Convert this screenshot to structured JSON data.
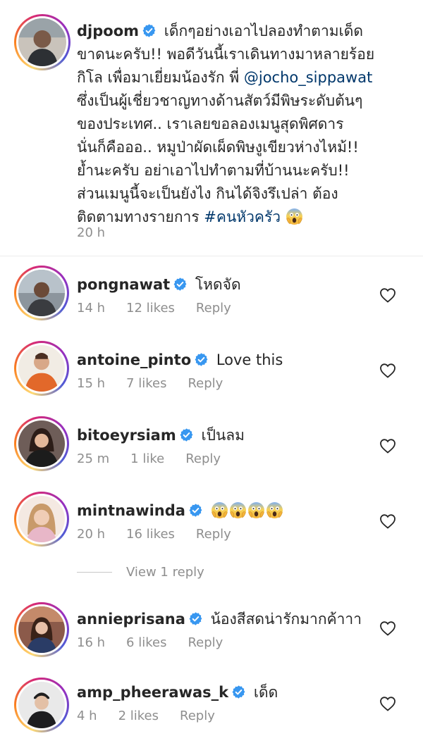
{
  "caption": {
    "username": "djpoom",
    "lines": [
      "เด็กๆอย่างเอาไปลองทำตามเด็ด",
      "ขาดนะครับ!! พอดีวันนี้เราเดินทางมาหลายร้อย",
      "กิโล เพื่อมาเยี่ยมน้องรัก พี่",
      "ซึ่งเป็นผู้เชี่ยวชาญทางด้านสัตว์มีพิษระดับต้นๆ",
      "ของประเทศ.. เราเลยขอลองเมนูสุดพิศดาร",
      "นั่นก็คือออ.. หมูป่าผัดเผ็ดพิษงูเขียวห่างไหม้!!",
      "ย้ำนะครับ อย่าเอาไปทำตามที่บ้านนะครับ!!",
      "ส่วนเมนูนี้จะเป็นยังไง กินได้จิงรึเปล่า ต้อง",
      "ติดตามทางรายการ"
    ],
    "mention": "@jocho_sippawat",
    "hashtag": "#คนหัวครัว",
    "time": "20 h"
  },
  "comments": [
    {
      "username": "pongnawat",
      "text": "โหดจัด",
      "time": "14 h",
      "likes": "12 likes",
      "reply": "Reply"
    },
    {
      "username": "antoine_pinto",
      "text": "Love this",
      "time": "15 h",
      "likes": "7 likes",
      "reply": "Reply"
    },
    {
      "username": "bitoeyrsiam",
      "text": "เป็นลม",
      "time": "25 m",
      "likes": "1 like",
      "reply": "Reply"
    },
    {
      "username": "mintnawinda",
      "text": "",
      "time": "20 h",
      "likes": "16 likes",
      "reply": "Reply"
    },
    {
      "username": "annieprisana",
      "text": "น้องสีสดน่ารักมากค้าาา",
      "time": "16 h",
      "likes": "6 likes",
      "reply": "Reply"
    },
    {
      "username": "amp_pheerawas_k",
      "text": "เด็ด",
      "time": "4 h",
      "likes": "2 likes",
      "reply": "Reply"
    }
  ],
  "view_replies": "View 1 reply",
  "icons": {
    "verified": "verified-badge-icon",
    "heart": "heart-outline-icon",
    "emoji": "face-screaming-in-fear-emoji"
  },
  "colors": {
    "verified": "#3897f0",
    "link": "#00376b",
    "meta": "#8e8e8e"
  }
}
